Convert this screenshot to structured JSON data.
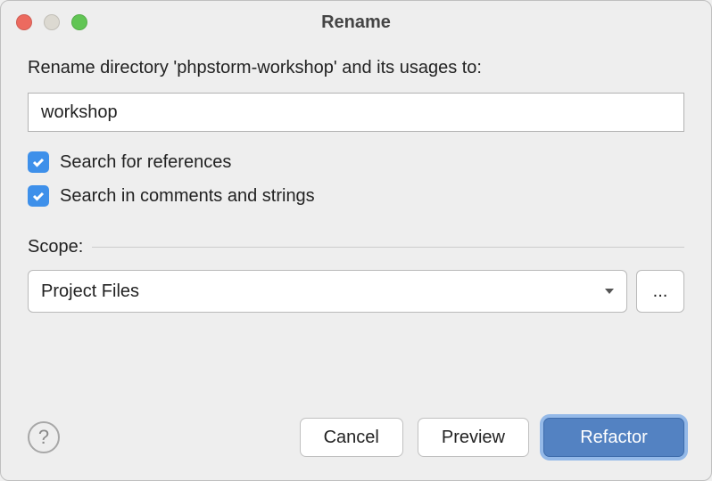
{
  "window": {
    "title": "Rename"
  },
  "prompt": "Rename directory 'phpstorm-workshop' and its usages to:",
  "input": {
    "value": "workshop"
  },
  "checkboxes": {
    "searchReferences": {
      "label": "Search for references",
      "checked": true
    },
    "searchComments": {
      "label": "Search in comments and strings",
      "checked": true
    }
  },
  "scope": {
    "label": "Scope:",
    "selected": "Project Files",
    "ellipsis": "..."
  },
  "buttons": {
    "help": "?",
    "cancel": "Cancel",
    "preview": "Preview",
    "refactor": "Refactor"
  }
}
